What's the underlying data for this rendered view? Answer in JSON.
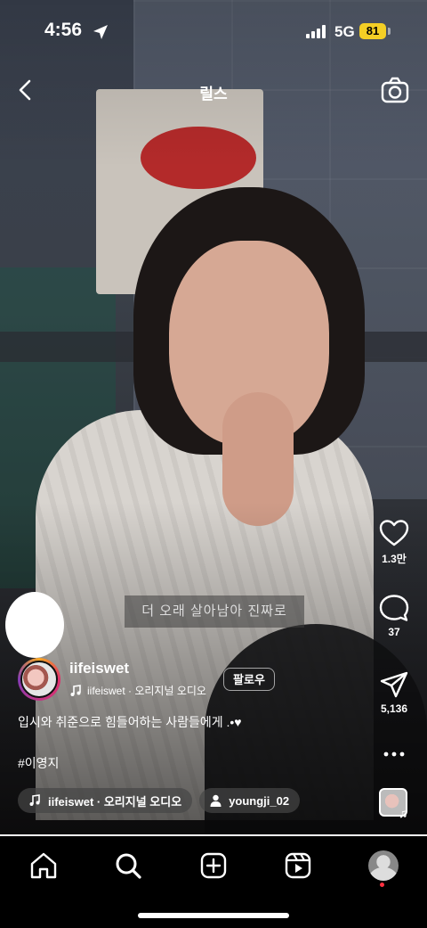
{
  "status_bar": {
    "time": "4:56",
    "network": "5G",
    "battery": "81"
  },
  "header": {
    "title": "릴스"
  },
  "video": {
    "subtitle_text": "더 오래 살아남아 진짜로",
    "progress": 1.0
  },
  "actions": {
    "likes": "1.3만",
    "comments": "37",
    "shares": "5,136"
  },
  "post": {
    "username": "iifeiswet",
    "audio_label": "iifeiswet · 오리지널 오디오",
    "follow_label": "팔로우",
    "caption": "입시와 취준으로 힘들어하는 사람들에게 .•♥",
    "hashtag": "#이영지",
    "chip_audio": "iifeiswet · 오리지널 오디오",
    "chip_user": "youngji_02"
  },
  "tabs": [
    "home-icon",
    "search-icon",
    "create-icon",
    "reels-icon",
    "profile-icon"
  ]
}
